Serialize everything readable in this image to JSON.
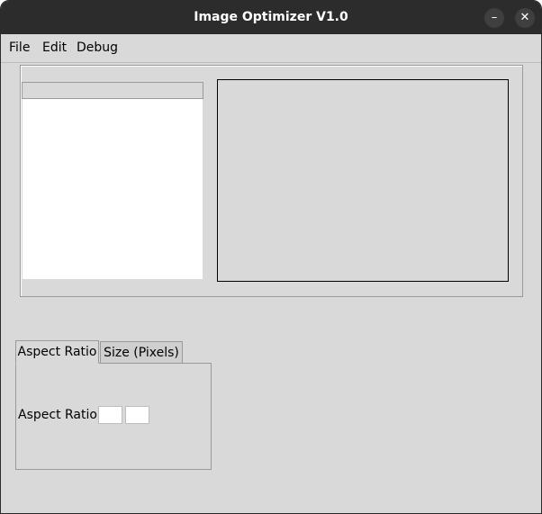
{
  "window": {
    "title": "Image Optimizer V1.0",
    "minimize_glyph": "–",
    "close_glyph": "✕"
  },
  "menubar": {
    "items": [
      {
        "label": "File"
      },
      {
        "label": "Edit"
      },
      {
        "label": "Debug"
      }
    ]
  },
  "image_list": {
    "header": "",
    "items": []
  },
  "tabs": [
    {
      "label": "Aspect Ratio",
      "selected": true
    },
    {
      "label": "Size (Pixels)",
      "selected": false
    }
  ],
  "aspect_ratio": {
    "label": "Aspect Ratio:",
    "width_value": "",
    "height_value": ""
  },
  "icons": {
    "minimize": "minimize-icon",
    "close": "close-icon"
  },
  "colors": {
    "titlebar": "#2c2c2c",
    "background": "#d9d9d9",
    "list_background": "#ffffff"
  }
}
